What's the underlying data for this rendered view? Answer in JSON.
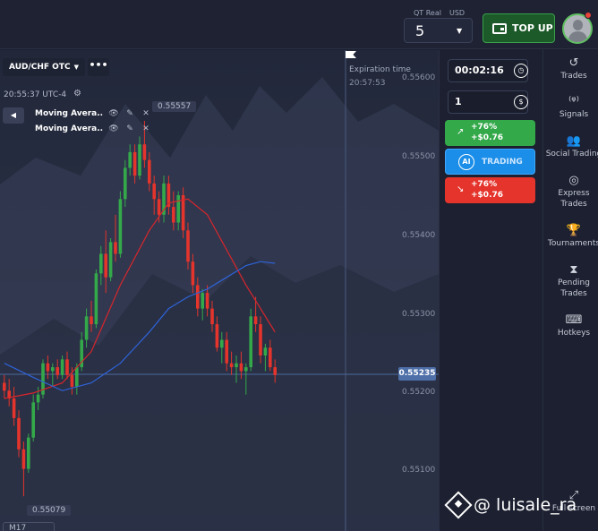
{
  "account": {
    "type": "QT Real",
    "currency": "USD",
    "balance": "5"
  },
  "topup_label": "TOP UP",
  "pair": "AUD/CHF OTC",
  "clock": "20:55:37 UTC-4",
  "indicators": [
    {
      "name": "Moving Avera..."
    },
    {
      "name": "Moving Avera..."
    }
  ],
  "price_axis": [
    "0.55600",
    "0.55500",
    "0.55400",
    "0.55300",
    "0.55200",
    "0.55100"
  ],
  "current_price": "0.55235",
  "high_label": "0.55557",
  "low_label": "0.55079",
  "expiration": {
    "title": "Expiration time",
    "time": "20:57:53"
  },
  "timeframe": "M17",
  "trade": {
    "duration": "00:02:16",
    "amount": "1",
    "buy": {
      "pct": "+76%",
      "amount": "+$0.76"
    },
    "sell": {
      "pct": "+76%",
      "amount": "+$0.76"
    },
    "ai_badge": "AI",
    "ai_label": "TRADING"
  },
  "sidebar": [
    {
      "label": "Trades",
      "icon": "history-icon"
    },
    {
      "label": "Signals",
      "icon": "signals-icon"
    },
    {
      "label": "Social Trading",
      "icon": "social-icon"
    },
    {
      "label": "Express Trades",
      "icon": "target-icon"
    },
    {
      "label": "Tournaments",
      "icon": "trophy-icon"
    },
    {
      "label": "Pending Trades",
      "icon": "hourglass-icon"
    },
    {
      "label": "Hotkeys",
      "icon": "keyboard-icon"
    },
    {
      "label": "Full screen",
      "icon": "fullscreen-icon"
    }
  ],
  "watermark": "@ luisale_ra",
  "colors": {
    "bull": "#34a94a",
    "bear": "#e4342c",
    "ma_fast": "#d8262c",
    "ma_slow": "#2e63d8",
    "topup": "#1c5a2a",
    "ai": "#1a8ee8"
  },
  "chart_data": {
    "type": "candlestick",
    "xlabel": "",
    "ylabel": "",
    "ylim": [
      0.55055,
      0.55615
    ],
    "candles": [
      {
        "o": 0.55225,
        "h": 0.55235,
        "l": 0.55205,
        "c": 0.55215
      },
      {
        "o": 0.55215,
        "h": 0.5523,
        "l": 0.55195,
        "c": 0.55205
      },
      {
        "o": 0.55205,
        "h": 0.5522,
        "l": 0.5517,
        "c": 0.5518
      },
      {
        "o": 0.5518,
        "h": 0.5519,
        "l": 0.5513,
        "c": 0.5514
      },
      {
        "o": 0.5514,
        "h": 0.5515,
        "l": 0.5508,
        "c": 0.55115
      },
      {
        "o": 0.55115,
        "h": 0.5516,
        "l": 0.5511,
        "c": 0.55155
      },
      {
        "o": 0.55155,
        "h": 0.5521,
        "l": 0.5515,
        "c": 0.552
      },
      {
        "o": 0.552,
        "h": 0.5522,
        "l": 0.5519,
        "c": 0.5521
      },
      {
        "o": 0.5521,
        "h": 0.55255,
        "l": 0.55205,
        "c": 0.5525
      },
      {
        "o": 0.5525,
        "h": 0.5526,
        "l": 0.5523,
        "c": 0.5524
      },
      {
        "o": 0.5524,
        "h": 0.5525,
        "l": 0.5522,
        "c": 0.55245
      },
      {
        "o": 0.55245,
        "h": 0.55255,
        "l": 0.5523,
        "c": 0.55235
      },
      {
        "o": 0.55235,
        "h": 0.5526,
        "l": 0.5523,
        "c": 0.55255
      },
      {
        "o": 0.55255,
        "h": 0.55265,
        "l": 0.5523,
        "c": 0.55235
      },
      {
        "o": 0.55235,
        "h": 0.55245,
        "l": 0.5521,
        "c": 0.5522
      },
      {
        "o": 0.5522,
        "h": 0.5525,
        "l": 0.5521,
        "c": 0.55245
      },
      {
        "o": 0.55245,
        "h": 0.5529,
        "l": 0.5524,
        "c": 0.5528
      },
      {
        "o": 0.5528,
        "h": 0.5532,
        "l": 0.5527,
        "c": 0.5531
      },
      {
        "o": 0.5531,
        "h": 0.5533,
        "l": 0.5529,
        "c": 0.553
      },
      {
        "o": 0.553,
        "h": 0.5537,
        "l": 0.55295,
        "c": 0.55365
      },
      {
        "o": 0.55365,
        "h": 0.554,
        "l": 0.5535,
        "c": 0.5539
      },
      {
        "o": 0.5539,
        "h": 0.5542,
        "l": 0.5534,
        "c": 0.5536
      },
      {
        "o": 0.5536,
        "h": 0.5541,
        "l": 0.55355,
        "c": 0.55405
      },
      {
        "o": 0.55405,
        "h": 0.5544,
        "l": 0.5538,
        "c": 0.5539
      },
      {
        "o": 0.5539,
        "h": 0.5547,
        "l": 0.55385,
        "c": 0.5546
      },
      {
        "o": 0.5546,
        "h": 0.5551,
        "l": 0.5545,
        "c": 0.555
      },
      {
        "o": 0.555,
        "h": 0.5553,
        "l": 0.5549,
        "c": 0.5552
      },
      {
        "o": 0.5552,
        "h": 0.5553,
        "l": 0.5548,
        "c": 0.5549
      },
      {
        "o": 0.5549,
        "h": 0.5554,
        "l": 0.55485,
        "c": 0.5553
      },
      {
        "o": 0.5553,
        "h": 0.5556,
        "l": 0.555,
        "c": 0.5551
      },
      {
        "o": 0.5551,
        "h": 0.5552,
        "l": 0.5547,
        "c": 0.5548
      },
      {
        "o": 0.5548,
        "h": 0.5549,
        "l": 0.5544,
        "c": 0.5546
      },
      {
        "o": 0.5546,
        "h": 0.5547,
        "l": 0.5543,
        "c": 0.5544
      },
      {
        "o": 0.5544,
        "h": 0.5549,
        "l": 0.5543,
        "c": 0.5548
      },
      {
        "o": 0.5548,
        "h": 0.5549,
        "l": 0.5544,
        "c": 0.5545
      },
      {
        "o": 0.5545,
        "h": 0.5547,
        "l": 0.5542,
        "c": 0.5543
      },
      {
        "o": 0.5543,
        "h": 0.5547,
        "l": 0.5542,
        "c": 0.55465
      },
      {
        "o": 0.55465,
        "h": 0.55475,
        "l": 0.5541,
        "c": 0.5542
      },
      {
        "o": 0.5542,
        "h": 0.5543,
        "l": 0.5537,
        "c": 0.5538
      },
      {
        "o": 0.5538,
        "h": 0.5539,
        "l": 0.5534,
        "c": 0.5535
      },
      {
        "o": 0.5535,
        "h": 0.5536,
        "l": 0.5531,
        "c": 0.5532
      },
      {
        "o": 0.5532,
        "h": 0.55345,
        "l": 0.55305,
        "c": 0.5534
      },
      {
        "o": 0.5534,
        "h": 0.5535,
        "l": 0.5531,
        "c": 0.5532
      },
      {
        "o": 0.5532,
        "h": 0.5533,
        "l": 0.5529,
        "c": 0.553
      },
      {
        "o": 0.553,
        "h": 0.5531,
        "l": 0.55265,
        "c": 0.5527
      },
      {
        "o": 0.5527,
        "h": 0.5529,
        "l": 0.5525,
        "c": 0.5528
      },
      {
        "o": 0.5528,
        "h": 0.5529,
        "l": 0.5524,
        "c": 0.5525
      },
      {
        "o": 0.5525,
        "h": 0.55265,
        "l": 0.55235,
        "c": 0.55245
      },
      {
        "o": 0.55245,
        "h": 0.5526,
        "l": 0.55225,
        "c": 0.5525
      },
      {
        "o": 0.5525,
        "h": 0.55265,
        "l": 0.5523,
        "c": 0.5524
      },
      {
        "o": 0.5524,
        "h": 0.5525,
        "l": 0.5521,
        "c": 0.55245
      },
      {
        "o": 0.55245,
        "h": 0.5532,
        "l": 0.5524,
        "c": 0.5531
      },
      {
        "o": 0.5531,
        "h": 0.55335,
        "l": 0.5529,
        "c": 0.553
      },
      {
        "o": 0.553,
        "h": 0.5531,
        "l": 0.5525,
        "c": 0.5526
      },
      {
        "o": 0.5526,
        "h": 0.55275,
        "l": 0.5524,
        "c": 0.5527
      },
      {
        "o": 0.5527,
        "h": 0.5528,
        "l": 0.5524,
        "c": 0.55245
      },
      {
        "o": 0.55245,
        "h": 0.55255,
        "l": 0.55225,
        "c": 0.55235
      }
    ],
    "ma_fast": [
      [
        0,
        0.55205
      ],
      [
        6,
        0.55212
      ],
      [
        12,
        0.55225
      ],
      [
        18,
        0.55265
      ],
      [
        24,
        0.5535
      ],
      [
        30,
        0.5542
      ],
      [
        34,
        0.55455
      ],
      [
        38,
        0.5546
      ],
      [
        42,
        0.5544
      ],
      [
        46,
        0.55395
      ],
      [
        50,
        0.5535
      ],
      [
        53,
        0.5532
      ],
      [
        56,
        0.5529
      ]
    ],
    "ma_slow": [
      [
        0,
        0.5525
      ],
      [
        6,
        0.55232
      ],
      [
        12,
        0.55215
      ],
      [
        18,
        0.55225
      ],
      [
        24,
        0.5525
      ],
      [
        30,
        0.5529
      ],
      [
        34,
        0.5532
      ],
      [
        38,
        0.55335
      ],
      [
        42,
        0.55345
      ],
      [
        46,
        0.5536
      ],
      [
        50,
        0.55375
      ],
      [
        53,
        0.5538
      ],
      [
        56,
        0.55378
      ]
    ]
  }
}
